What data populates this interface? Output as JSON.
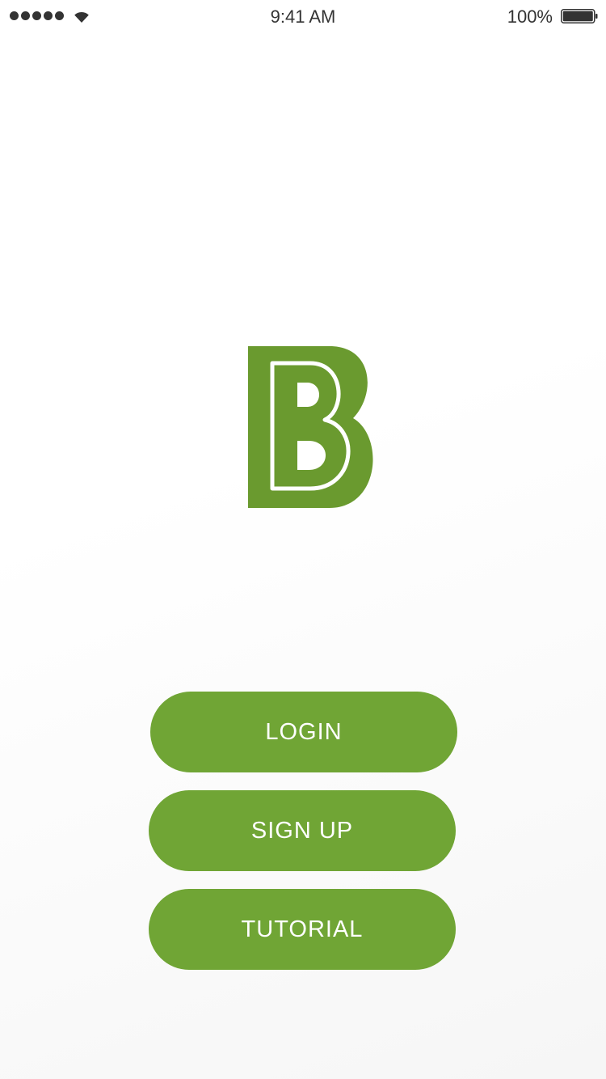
{
  "status_bar": {
    "time": "9:41 AM",
    "battery_percent": "100%",
    "signal_strength": 5,
    "battery_level": 1.0,
    "icons": [
      "signal-dots-icon",
      "wifi-icon",
      "battery-icon"
    ]
  },
  "logo": {
    "icon": "brand-b-logo-icon",
    "color": "#6a9a2f"
  },
  "buttons": {
    "login_label": "LOGIN",
    "signup_label": "SIGN UP",
    "tutorial_label": "TUTORIAL"
  },
  "colors": {
    "accent": "#70a535",
    "button_text": "#ffffff",
    "background": "#ffffff"
  }
}
